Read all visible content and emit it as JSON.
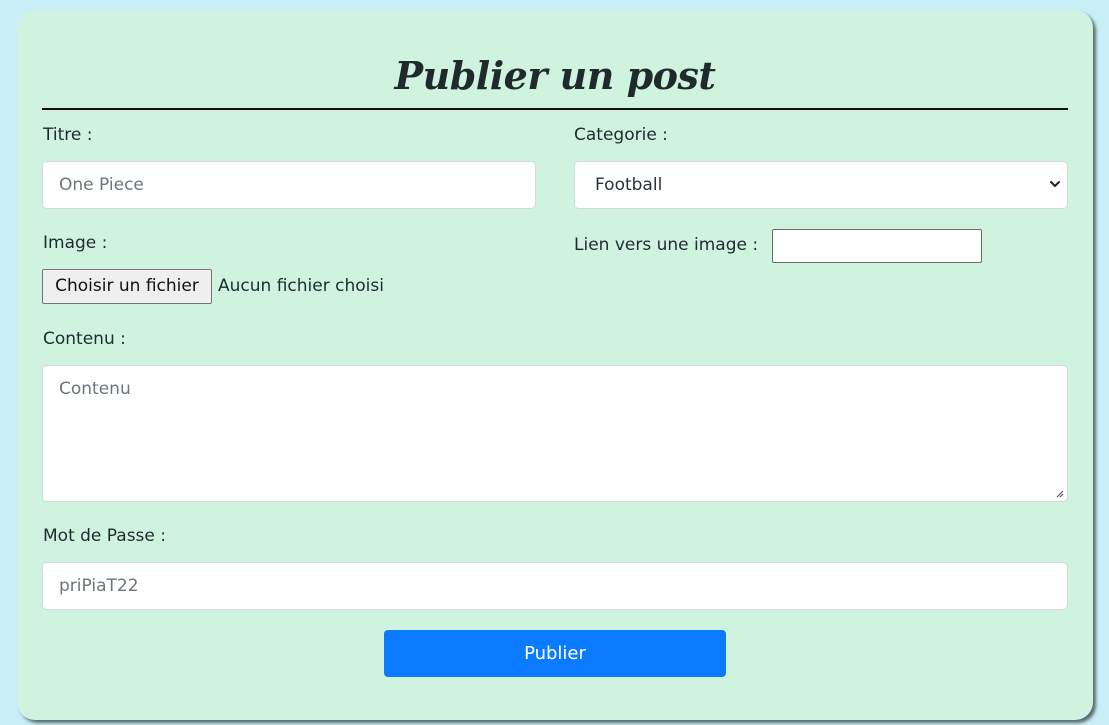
{
  "form": {
    "title": "Publier un post",
    "titre": {
      "label": "Titre :",
      "placeholder": "One Piece"
    },
    "categorie": {
      "label": "Categorie :",
      "selected": "Football"
    },
    "image": {
      "label": "Image :",
      "file_button": "Choisir un fichier",
      "file_status": "Aucun fichier choisi"
    },
    "lien_image": {
      "label": "Lien vers une image :",
      "value": ""
    },
    "contenu": {
      "label": "Contenu :",
      "placeholder": "Contenu"
    },
    "mot_de_passe": {
      "label": "Mot de Passe :",
      "value": "priPiaT22"
    },
    "submit_label": "Publier"
  },
  "colors": {
    "page_background": "#c8eff8",
    "card_background": "#d0f3e0",
    "submit_button": "#0a7bff"
  },
  "icons": {
    "select_arrow": "chevron-down-icon",
    "textarea_resize": "resize-handle-icon"
  }
}
